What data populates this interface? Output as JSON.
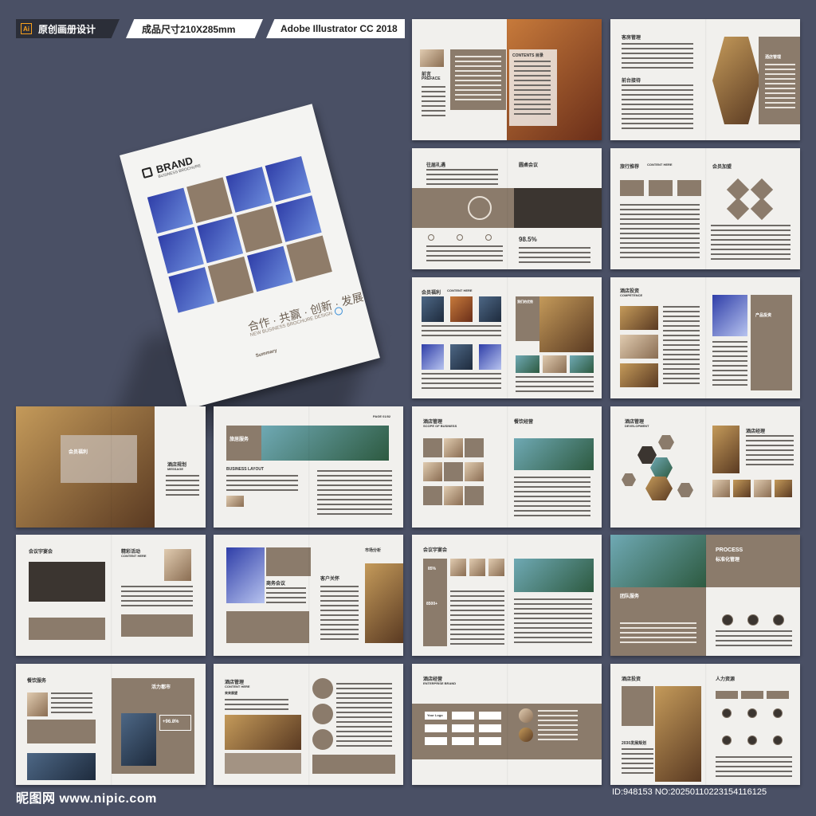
{
  "header": {
    "ai_badge": "Ai",
    "label_1": "原创画册设计",
    "label_2": "成品尺寸210X285mm",
    "label_3": "Adobe Illustrator CC 2018"
  },
  "cover": {
    "brand": "BRAND",
    "brand_sub": "BUSINESS BROCHURE",
    "title_cn": "合作 · 共赢 · 创新 · 发展",
    "title_en": "NEW BUSINESS  BROCHURE DESIGN",
    "summary": "Summary"
  },
  "spreads": [
    {
      "a": "前言",
      "b": "PREFACE",
      "c": "CONTENTS 目录"
    },
    {
      "a": "客房管理",
      "b": "前台接待",
      "c": "酒店管理"
    },
    {
      "a": "往届礼遇",
      "b": "圆桌会议",
      "c": "98.5%"
    },
    {
      "a": "旅行推荐",
      "b": "会员加盟",
      "c": "CONTENT HERE"
    },
    {
      "a": "会员福利",
      "b": "CONTENT HERE",
      "c": "我们的优势"
    },
    {
      "a": "酒店投资",
      "b": "COMPETENCE",
      "c": "产品投资"
    },
    {
      "a": "会员福利",
      "b": "酒店规划",
      "c": "MESSAGE"
    },
    {
      "a": "旅居服务",
      "b": "BUSINESS LAYOUT",
      "c": "PAGE 01/02"
    },
    {
      "a": "酒店管理",
      "b": "餐饮经营",
      "c": "SCOPE OF BUSINESS"
    },
    {
      "a": "酒店管理",
      "b": "酒店经理",
      "c": "DEVELOPMENT"
    },
    {
      "a": "会议宇宴会",
      "b": "精彩活动",
      "c": "CONTENT HERE"
    },
    {
      "a": "商务会议",
      "b": "客户关怀",
      "c": "市场分析"
    },
    {
      "a": "会议宇宴会",
      "b": "85%",
      "c": "8500+"
    },
    {
      "a": "PROCESS",
      "b": "标准化管理",
      "c": "团队服务"
    },
    {
      "a": "餐饮服务",
      "b": "活力都市",
      "c": "+96.8%"
    },
    {
      "a": "酒店管理",
      "b": "CONTENT HERE",
      "c": "来来展望"
    },
    {
      "a": "酒店经营",
      "b": "ENTERPRISE BRAND",
      "c": "Your Logo"
    },
    {
      "a": "酒店投资",
      "b": "人力资源",
      "c": "2030发展规划"
    }
  ],
  "footer": {
    "left": "昵图网 www.nipic.com",
    "right": "ID:948153 NO:20250110223154116125"
  }
}
